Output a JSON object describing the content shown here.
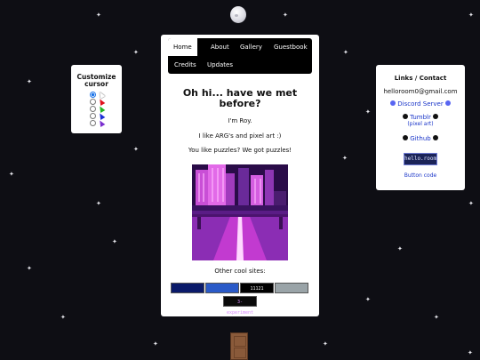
{
  "cursor_panel": {
    "title": "Customize cursor",
    "options": [
      {
        "color": "#ffffff",
        "selected": true
      },
      {
        "color": "#e0121e",
        "selected": false
      },
      {
        "color": "#23b423",
        "selected": false
      },
      {
        "color": "#1c2fd6",
        "selected": false
      },
      {
        "color": "#7b2fcf",
        "selected": false
      }
    ]
  },
  "nav": {
    "items": [
      "Home",
      "About",
      "Gallery",
      "Guestbook",
      "Credits",
      "Updates"
    ],
    "active": "Home"
  },
  "main": {
    "heading": "Oh hi... have we met before?",
    "line1": "I'm Roy.",
    "line2": "I like ARG's and pixel art :)",
    "line3": "You like puzzles? We got puzzles!",
    "other_sites_label": "Other cool sites:",
    "badges": [
      {
        "text": "",
        "bg": "#0a1a6a",
        "fg": "#3a8bff"
      },
      {
        "text": "",
        "bg": "#2a5ac8",
        "fg": "#ffffff"
      },
      {
        "text": "11121",
        "bg": "#000000",
        "fg": "#ffffff"
      },
      {
        "text": "",
        "bg": "#9aa4a8",
        "fg": "#ffffff"
      },
      {
        "text": "3-experiment",
        "bg": "#0a0a0a",
        "fg": "#d98cff"
      }
    ]
  },
  "links": {
    "title": "Links / Contact",
    "email": "helloroom0@gmail.com",
    "discord": "Discord Server",
    "tumblr": "Tumblr",
    "tumblr_sub": "(pixel art)",
    "github": "Github",
    "badge_text": "hello.room",
    "button_code": "Button code"
  },
  "colors": {
    "background": "#0e0e14",
    "panel": "#ffffff",
    "nav": "#000000",
    "link": "#1a35c9"
  }
}
